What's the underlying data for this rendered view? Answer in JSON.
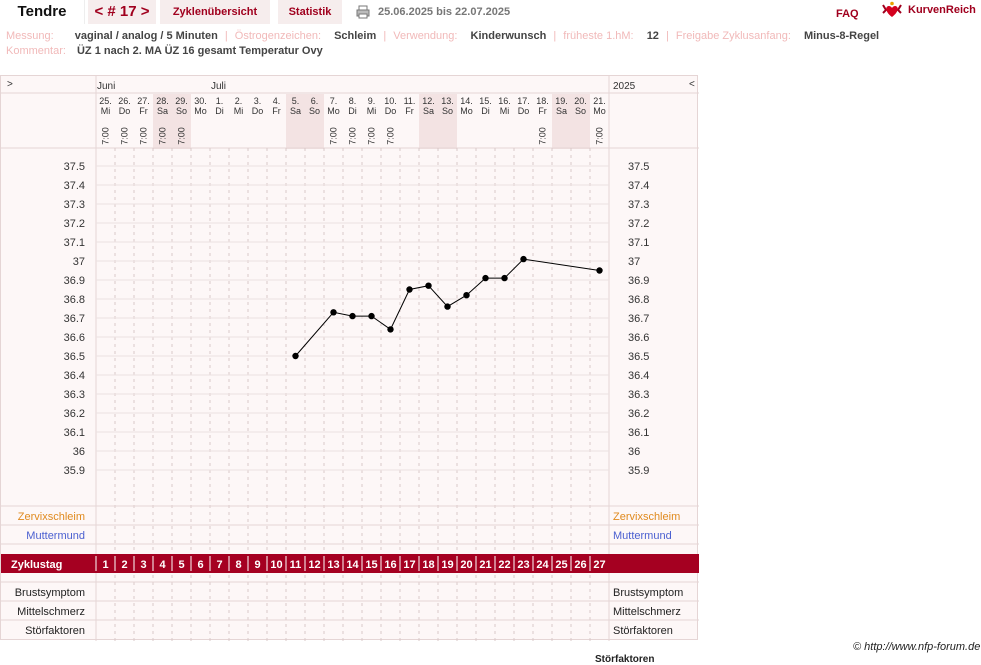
{
  "header": {
    "name": "Tendre",
    "cycle_nav": "< # 17 >",
    "tabs": [
      {
        "label": "Zyklenübersicht"
      },
      {
        "label": "Statistik"
      }
    ],
    "date_range": "25.06.2025 bis 22.07.2025",
    "faq": "FAQ",
    "brand": "KurvenReich"
  },
  "info": {
    "messung_label": "Messung:",
    "messung_value": "vaginal / analog / 5 Minuten",
    "oestrogen_label": "Östrogenzeichen:",
    "oestrogen_value": "Schleim",
    "verwendung_label": "Verwendung:",
    "verwendung_value": "Kinderwunsch",
    "fhm_label": "früheste 1.hM:",
    "fhm_value": "12",
    "freigabe_label": "Freigabe Zyklusanfang:",
    "freigabe_value": "Minus-8-Regel",
    "kommentar_label": "Kommentar:",
    "kommentar_value": "ÜZ 1 nach 2. MA ÜZ 16 gesamt Temperatur Ovy"
  },
  "chart_data": {
    "type": "line",
    "nav_left": ">",
    "nav_right": "<",
    "year": "2025",
    "months": [
      {
        "label": "Juni",
        "col": 0
      },
      {
        "label": "Juli",
        "col": 6
      }
    ],
    "days": [
      {
        "date": "25.",
        "wd": "Mi",
        "time": "7:00",
        "weekend": false
      },
      {
        "date": "26.",
        "wd": "Do",
        "time": "7:00",
        "weekend": false
      },
      {
        "date": "27.",
        "wd": "Fr",
        "time": "7:00",
        "weekend": false
      },
      {
        "date": "28.",
        "wd": "Sa",
        "time": "7:00",
        "weekend": true
      },
      {
        "date": "29.",
        "wd": "So",
        "time": "7:00",
        "weekend": true
      },
      {
        "date": "30.",
        "wd": "Mo",
        "time": "",
        "weekend": false
      },
      {
        "date": "1.",
        "wd": "Di",
        "time": "",
        "weekend": false
      },
      {
        "date": "2.",
        "wd": "Mi",
        "time": "",
        "weekend": false
      },
      {
        "date": "3.",
        "wd": "Do",
        "time": "",
        "weekend": false
      },
      {
        "date": "4.",
        "wd": "Fr",
        "time": "",
        "weekend": false
      },
      {
        "date": "5.",
        "wd": "Sa",
        "time": "",
        "weekend": true
      },
      {
        "date": "6.",
        "wd": "So",
        "time": "",
        "weekend": true
      },
      {
        "date": "7.",
        "wd": "Mo",
        "time": "7:00",
        "weekend": false
      },
      {
        "date": "8.",
        "wd": "Di",
        "time": "7:00",
        "weekend": false
      },
      {
        "date": "9.",
        "wd": "Mi",
        "time": "7:00",
        "weekend": false
      },
      {
        "date": "10.",
        "wd": "Do",
        "time": "7:00",
        "weekend": false
      },
      {
        "date": "11.",
        "wd": "Fr",
        "time": "",
        "weekend": false
      },
      {
        "date": "12.",
        "wd": "Sa",
        "time": "",
        "weekend": true
      },
      {
        "date": "13.",
        "wd": "So",
        "time": "",
        "weekend": true
      },
      {
        "date": "14.",
        "wd": "Mo",
        "time": "",
        "weekend": false
      },
      {
        "date": "15.",
        "wd": "Di",
        "time": "",
        "weekend": false
      },
      {
        "date": "16.",
        "wd": "Mi",
        "time": "",
        "weekend": false
      },
      {
        "date": "17.",
        "wd": "Do",
        "time": "",
        "weekend": false
      },
      {
        "date": "18.",
        "wd": "Fr",
        "time": "7:00",
        "weekend": false
      },
      {
        "date": "19.",
        "wd": "Sa",
        "time": "",
        "weekend": true
      },
      {
        "date": "20.",
        "wd": "So",
        "time": "",
        "weekend": true
      },
      {
        "date": "21.",
        "wd": "Mo",
        "time": "7:00",
        "weekend": false
      }
    ],
    "y_ticks": [
      "37.5",
      "37.4",
      "37.3",
      "37.2",
      "37.1",
      "37",
      "36.9",
      "36.8",
      "36.7",
      "36.6",
      "36.5",
      "36.4",
      "36.3",
      "36.2",
      "36.1",
      "36",
      "35.9"
    ],
    "ylim": [
      35.9,
      37.5
    ],
    "temperatures": [
      {
        "day": 11,
        "value": 36.5
      },
      {
        "day": 13,
        "value": 36.73
      },
      {
        "day": 14,
        "value": 36.71
      },
      {
        "day": 15,
        "value": 36.71
      },
      {
        "day": 16,
        "value": 36.64
      },
      {
        "day": 17,
        "value": 36.85
      },
      {
        "day": 18,
        "value": 36.87
      },
      {
        "day": 19,
        "value": 36.76
      },
      {
        "day": 20,
        "value": 36.82
      },
      {
        "day": 21,
        "value": 36.91
      },
      {
        "day": 22,
        "value": 36.91
      },
      {
        "day": 23,
        "value": 37.01
      },
      {
        "day": 27,
        "value": 36.95
      }
    ],
    "rows": {
      "zervix": "Zervixschleim",
      "mutter": "Muttermund",
      "zyklustag": "Zyklustag",
      "brust": "Brustsymptom",
      "mittel": "Mittelschmerz",
      "stoer": "Störfaktoren"
    },
    "colors": {
      "zervix": "#e08a1e",
      "mutter": "#4a5fd0",
      "band": "#a50021",
      "line": "#000000"
    }
  },
  "footer": {
    "copyright": "© http://www.nfp-forum.de",
    "cut_label": "Störfaktoren"
  }
}
